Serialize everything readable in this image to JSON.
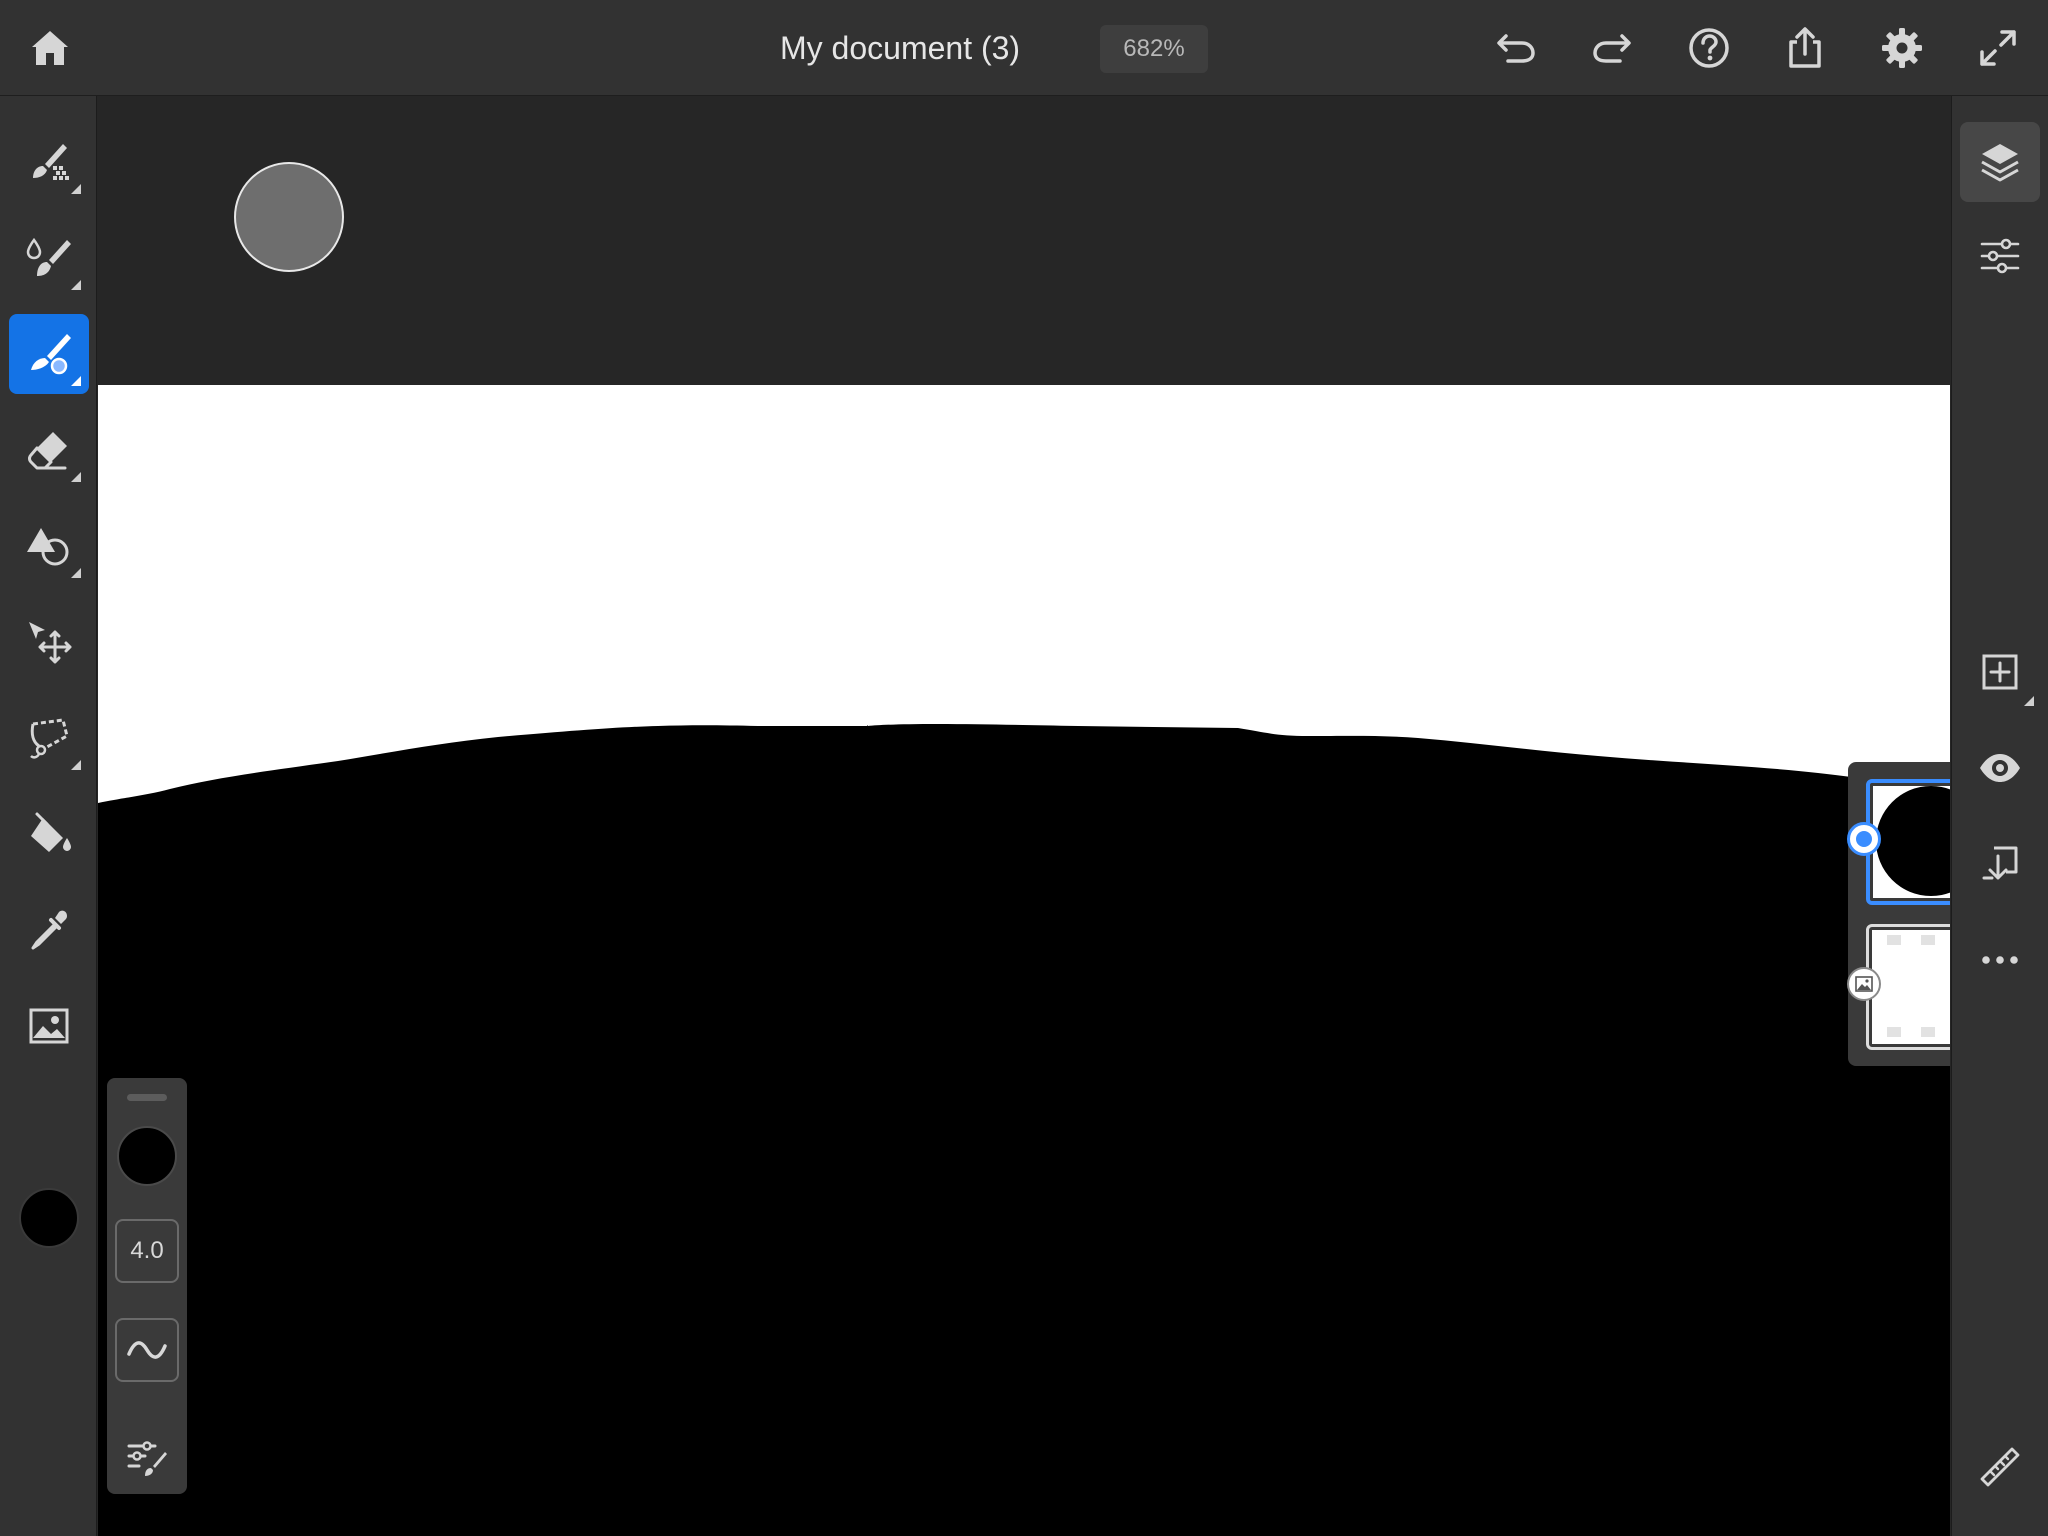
{
  "header": {
    "title": "My document (3)",
    "zoom": "682%",
    "icons": [
      "home-icon",
      "undo-icon",
      "redo-icon",
      "help-icon",
      "share-icon",
      "settings-icon",
      "fullscreen-icon"
    ]
  },
  "left_toolbar": {
    "tools": [
      "pixel-brush",
      "live-brush",
      "vector-brush",
      "eraser",
      "shape",
      "transform",
      "lasso",
      "fill",
      "eyedropper",
      "image"
    ],
    "active_tool": "vector-brush",
    "current_color": "#000000"
  },
  "right_toolbar": {
    "tools": [
      "layers",
      "layer-properties",
      "add-layer",
      "visibility",
      "merge-down",
      "more",
      "ruler"
    ],
    "active_tool": "layers"
  },
  "brush_panel": {
    "size": "4.0",
    "color": "#000000"
  },
  "layers_panel": {
    "selected_layer": 0,
    "layers": [
      "vector-layer",
      "image-layer"
    ]
  },
  "colors": {
    "accent": "#1473e6",
    "selection": "#3a8dff",
    "toolbar_bg": "#323232",
    "workspace_bg": "#262626"
  }
}
